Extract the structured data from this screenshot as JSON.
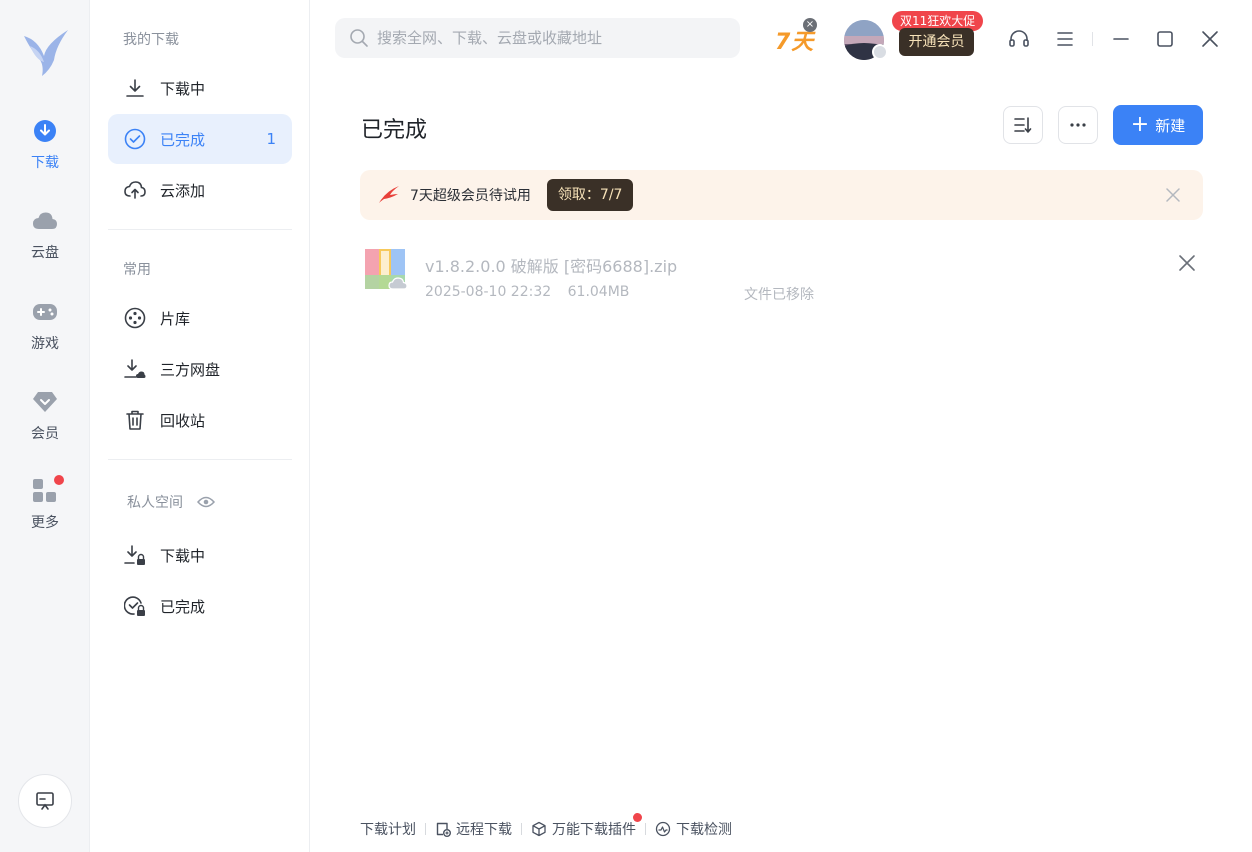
{
  "rail": {
    "items": [
      {
        "label": "下载"
      },
      {
        "label": "云盘"
      },
      {
        "label": "游戏"
      },
      {
        "label": "会员"
      },
      {
        "label": "更多"
      }
    ]
  },
  "sidebar": {
    "section_downloads": "我的下载",
    "downloading": "下载中",
    "completed": "已完成",
    "completed_count": "1",
    "cloud_add": "云添加",
    "section_common": "常用",
    "library": "片库",
    "third_party": "三方网盘",
    "recycle": "回收站",
    "section_private": "私人空间",
    "private_downloading": "下载中",
    "private_completed": "已完成"
  },
  "topbar": {
    "search_placeholder": "搜索全网、下载、云盘或收藏地址",
    "seven_day": "7天",
    "promo_tag": "双11狂欢大促",
    "vip_button": "开通会员"
  },
  "main": {
    "title": "已完成",
    "new_button": "新建",
    "banner_text": "7天超级会员待试用",
    "banner_pill": "领取：7/7"
  },
  "files": [
    {
      "name": "v1.8.2.0.0 破解版 [密码6688].zip",
      "date": "2025-08-10 22:32",
      "size": "61.04MB",
      "status": "文件已移除"
    }
  ],
  "footer": {
    "plan": "下载计划",
    "remote": "远程下载",
    "plugin": "万能下载插件",
    "check": "下载检测"
  },
  "colors": {
    "accent": "#3b82f6",
    "promo_red": "#f0454b",
    "vip_dark": "#3a3027",
    "banner_bg": "#fdf3ea"
  }
}
